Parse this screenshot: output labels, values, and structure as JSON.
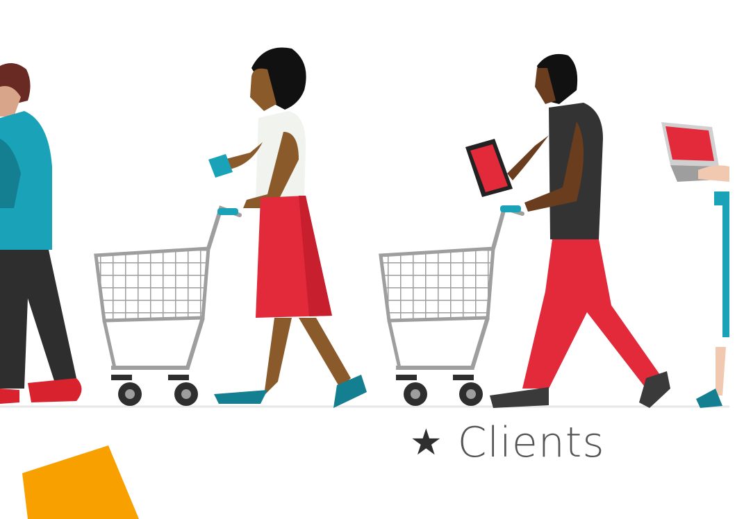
{
  "caption": {
    "icon": "star-icon",
    "star_glyph": "★",
    "label": "Clients"
  },
  "colors": {
    "teal": "#1aa3b8",
    "red": "#e22a3b",
    "dark": "#2e2e2e",
    "skin_dark": "#6b3d1f",
    "cart": "#9e9e9e",
    "orange": "#f7a000"
  }
}
